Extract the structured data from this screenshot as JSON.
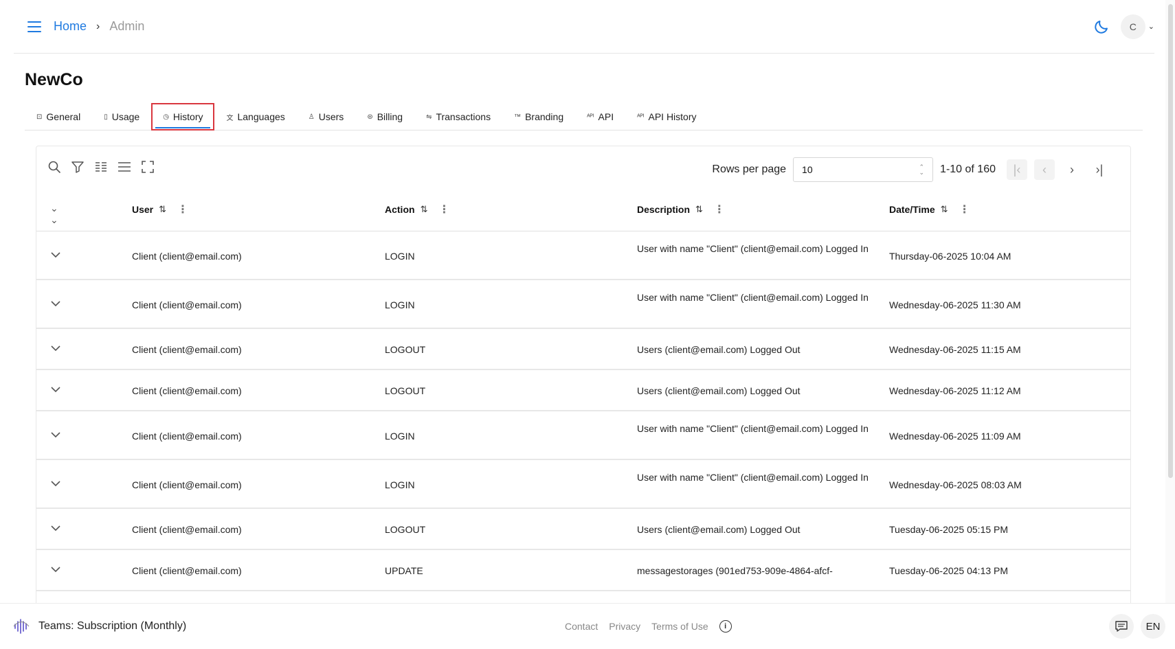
{
  "header": {
    "breadcrumb": {
      "home": "Home",
      "separator": "›",
      "current": "Admin"
    },
    "avatar_initial": "C",
    "icons": [
      "menu-icon",
      "moon-icon",
      "chevron-down-icon"
    ]
  },
  "page": {
    "title": "NewCo"
  },
  "tabs": [
    {
      "label": "General",
      "icon": "⊡"
    },
    {
      "label": "Usage",
      "icon": "▯"
    },
    {
      "label": "History",
      "icon": "◷",
      "active": true
    },
    {
      "label": "Languages",
      "icon": "文"
    },
    {
      "label": "Users",
      "icon": "♙"
    },
    {
      "label": "Billing",
      "icon": "⊜"
    },
    {
      "label": "Transactions",
      "icon": "⇋"
    },
    {
      "label": "Branding",
      "icon": "™"
    },
    {
      "label": "API",
      "icon": "ᴬᴾᴵ"
    },
    {
      "label": "API History",
      "icon": "ᴬᴾᴵ"
    }
  ],
  "toolbar": {
    "icons": [
      "search-icon",
      "filter-icon",
      "columns-icon",
      "density-icon",
      "fullscreen-icon"
    ],
    "rows_per_page_label": "Rows per page",
    "rows_per_page_value": "10",
    "range": "1-10 of 160"
  },
  "table": {
    "columns": [
      "User",
      "Action",
      "Description",
      "Date/Time"
    ],
    "rows": [
      {
        "user": "Client (client@email.com)",
        "action": "LOGIN",
        "description": "User with name \"Client\" (client@email.com) Logged In",
        "datetime": "Thursday-06-2025 10:04 AM"
      },
      {
        "user": "Client (client@email.com)",
        "action": "LOGIN",
        "description": "User with name \"Client\" (client@email.com) Logged In",
        "datetime": "Wednesday-06-2025 11:30 AM"
      },
      {
        "user": "Client (client@email.com)",
        "action": "LOGOUT",
        "description": "Users (client@email.com) Logged Out",
        "datetime": "Wednesday-06-2025 11:15 AM"
      },
      {
        "user": "Client (client@email.com)",
        "action": "LOGOUT",
        "description": "Users (client@email.com) Logged Out",
        "datetime": "Wednesday-06-2025 11:12 AM"
      },
      {
        "user": "Client (client@email.com)",
        "action": "LOGIN",
        "description": "User with name \"Client\" (client@email.com) Logged In",
        "datetime": "Wednesday-06-2025 11:09 AM"
      },
      {
        "user": "Client (client@email.com)",
        "action": "LOGIN",
        "description": "User with name \"Client\" (client@email.com) Logged In",
        "datetime": "Wednesday-06-2025 08:03 AM"
      },
      {
        "user": "Client (client@email.com)",
        "action": "LOGOUT",
        "description": "Users (client@email.com) Logged Out",
        "datetime": "Tuesday-06-2025 05:15 PM"
      },
      {
        "user": "Client (client@email.com)",
        "action": "UPDATE",
        "description": "messagestorages (901ed753-909e-4864-afcf-",
        "datetime": "Tuesday-06-2025 04:13 PM"
      }
    ]
  },
  "footer": {
    "plan": "Teams: Subscription (Monthly)",
    "links": [
      "Contact",
      "Privacy",
      "Terms of Use"
    ],
    "language": "EN"
  }
}
